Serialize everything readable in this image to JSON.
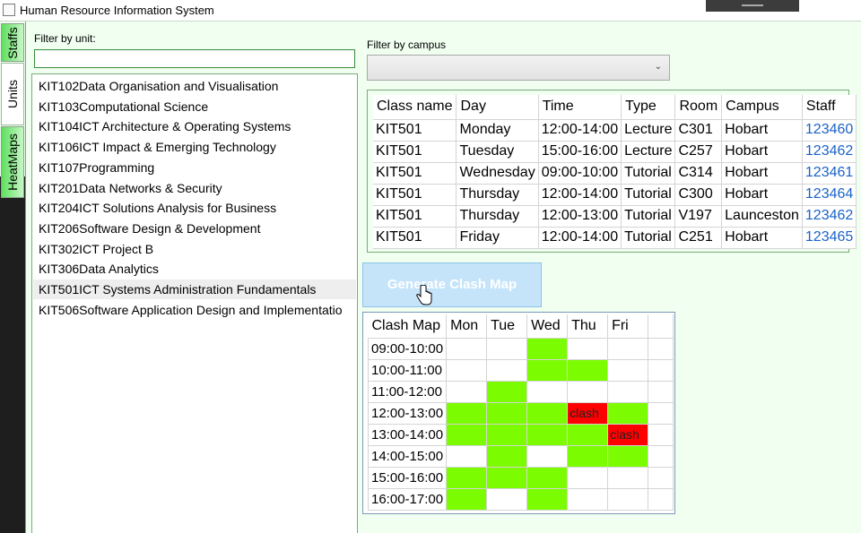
{
  "window": {
    "title": "Human Resource Information System"
  },
  "tabs": [
    {
      "label": "Staffs",
      "active": false
    },
    {
      "label": "Units",
      "active": true
    },
    {
      "label": "HeatMaps",
      "active": false
    }
  ],
  "unit_filter": {
    "label": "Filter by unit:",
    "value": "",
    "placeholder": ""
  },
  "units": [
    {
      "label": "KIT102Data Organisation and Visualisation",
      "selected": false
    },
    {
      "label": "KIT103Computational Science",
      "selected": false
    },
    {
      "label": "KIT104ICT Architecture & Operating Systems",
      "selected": false
    },
    {
      "label": "KIT106ICT Impact & Emerging Technology",
      "selected": false
    },
    {
      "label": "KIT107Programming",
      "selected": false
    },
    {
      "label": "KIT201Data Networks & Security",
      "selected": false
    },
    {
      "label": "KIT204ICT Solutions Analysis for Business",
      "selected": false
    },
    {
      "label": "KIT206Software Design & Development",
      "selected": false
    },
    {
      "label": "KIT302ICT Project B",
      "selected": false
    },
    {
      "label": "KIT306Data Analytics",
      "selected": false
    },
    {
      "label": "KIT501ICT Systems Administration Fundamentals",
      "selected": true
    },
    {
      "label": "KIT506Software Application Design and Implementatio",
      "selected": false
    }
  ],
  "campus_filter": {
    "label": "Filter by campus",
    "selected": ""
  },
  "class_table": {
    "columns": [
      "Class name",
      "Day",
      "Time",
      "Type",
      "Room",
      "Campus",
      "Staff"
    ],
    "rows": [
      [
        "KIT501",
        "Monday",
        "12:00-14:00",
        "Lecture",
        "C301",
        "Hobart",
        "123460"
      ],
      [
        "KIT501",
        "Tuesday",
        "15:00-16:00",
        "Lecture",
        "C257",
        "Hobart",
        "123462"
      ],
      [
        "KIT501",
        "Wednesday",
        "09:00-10:00",
        "Tutorial",
        "C314",
        "Hobart",
        "123461"
      ],
      [
        "KIT501",
        "Thursday",
        "12:00-14:00",
        "Tutorial",
        "C300",
        "Hobart",
        "123464"
      ],
      [
        "KIT501",
        "Thursday",
        "12:00-13:00",
        "Tutorial",
        "V197",
        "Launceston",
        "123462"
      ],
      [
        "KIT501",
        "Friday",
        "12:00-14:00",
        "Tutorial",
        "C251",
        "Hobart",
        "123465"
      ]
    ]
  },
  "generate_button": {
    "label": "Generate Clash Map"
  },
  "clash_map": {
    "columns": [
      "Clash Map",
      "Mon",
      "Tue",
      "Wed",
      "Thu",
      "Fri"
    ],
    "clash_label": "clash",
    "rows": [
      {
        "slot": "09:00-10:00",
        "cells": [
          "empty",
          "empty",
          "busy",
          "empty",
          "empty"
        ]
      },
      {
        "slot": "10:00-11:00",
        "cells": [
          "empty",
          "empty",
          "busy",
          "busy",
          "empty"
        ]
      },
      {
        "slot": "11:00-12:00",
        "cells": [
          "empty",
          "busy",
          "empty",
          "empty",
          "empty"
        ]
      },
      {
        "slot": "12:00-13:00",
        "cells": [
          "busy",
          "busy",
          "busy",
          "clash",
          "busy"
        ]
      },
      {
        "slot": "13:00-14:00",
        "cells": [
          "busy",
          "busy",
          "busy",
          "busy",
          "clash"
        ]
      },
      {
        "slot": "14:00-15:00",
        "cells": [
          "empty",
          "busy",
          "empty",
          "busy",
          "busy"
        ]
      },
      {
        "slot": "15:00-16:00",
        "cells": [
          "busy",
          "busy",
          "busy",
          "empty",
          "empty"
        ]
      },
      {
        "slot": "16:00-17:00",
        "cells": [
          "busy",
          "empty",
          "busy",
          "empty",
          "empty"
        ]
      }
    ]
  },
  "colors": {
    "busy": "#7cfc00",
    "clash": "#ff0000",
    "link": "#1a62c8",
    "background": "#f0fff0"
  },
  "icons": {
    "cursor": "hand-pointer-icon",
    "dropdown": "chevron-down-icon"
  }
}
